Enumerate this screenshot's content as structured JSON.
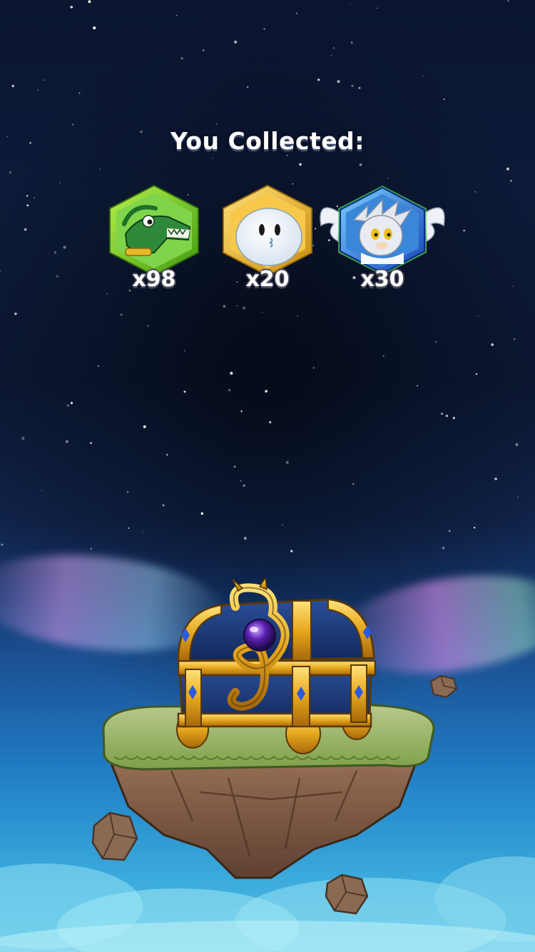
{
  "header": {
    "title": "You Collected:"
  },
  "rewards": [
    {
      "name": "Vector the Crocodile",
      "count_label": "x98",
      "frame_color": "#6ccb1e",
      "rarity": "common-green"
    },
    {
      "name": "Chao",
      "count_label": "x20",
      "frame_color": "#e7b21a",
      "rarity": "gold"
    },
    {
      "name": "Silver the Hedgehog",
      "count_label": "x30",
      "frame_color": "#2a6fe0",
      "rarity": "blue-winged"
    }
  ],
  "chest": {
    "icon": "dragon-treasure-chest-icon",
    "gem_color": "#5a1fb0"
  },
  "colors": {
    "sky_top": "#0b1530",
    "sky_bottom": "#52c3e6",
    "title_shadow": "#3a4a6a"
  }
}
